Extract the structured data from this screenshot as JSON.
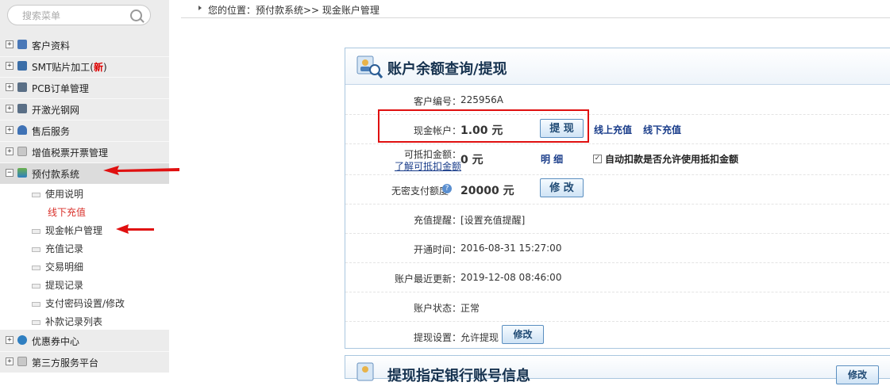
{
  "sidebar": {
    "search_placeholder": "搜索菜单",
    "menu": [
      {
        "label": "客户资料"
      },
      {
        "label": "SMT贴片加工(",
        "badge": "新",
        "suffix": ")"
      },
      {
        "label": "PCB订单管理"
      },
      {
        "label": "开激光钢网"
      },
      {
        "label": "售后服务"
      },
      {
        "label": "增值税票开票管理"
      },
      {
        "label": "预付款系统"
      }
    ],
    "submenu": [
      {
        "label": "使用说明"
      },
      {
        "label": "线下充值"
      },
      {
        "label": "现金帐户管理"
      },
      {
        "label": "充值记录"
      },
      {
        "label": "交易明细"
      },
      {
        "label": "提现记录"
      },
      {
        "label": "支付密码设置/修改"
      },
      {
        "label": "补款记录列表"
      }
    ],
    "menu_bottom": [
      {
        "label": "优惠券中心"
      },
      {
        "label": "第三方服务平台"
      }
    ]
  },
  "breadcrumb": "您的位置：预付款系统>> 现金账户管理",
  "panel": {
    "title": "账户余额查询/提现",
    "customer_id_label": "客户编号：",
    "customer_id": "225956A",
    "cash_label": "现金帐户：",
    "cash_value": "1.00 元",
    "withdraw_button": "提 现",
    "online_recharge": "线上充值",
    "offline_recharge": "线下充值",
    "deductible_label": "可抵扣金额：",
    "deductible_link": "了解可抵扣金额",
    "deductible_value": "0 元",
    "detail_link": "明 细",
    "auto_deduct_label": "自动扣款是否允许使用抵扣金额",
    "auto_deduct_checked": true,
    "nopwd_label": "无密支付额度",
    "nopwd_value": "20000 元",
    "modify_button": "修 改",
    "reminder_label": "充值提醒：",
    "reminder_value": "[设置充值提醒]",
    "open_time_label": "开通时间：",
    "open_time": "2016-08-31 15:27:00",
    "updated_label": "账户最近更新：",
    "updated_time": "2019-12-08 08:46:00",
    "status_label": "账户状态：",
    "status_value": "正常",
    "withdraw_setting_label": "提现设置：",
    "withdraw_setting_value": "允许提现",
    "withdraw_setting_button": "修改"
  },
  "panel2": {
    "title": "提现指定银行账号信息",
    "button": "修改"
  },
  "colors": {
    "accent_red": "#e00000",
    "link_blue": "#1a3d8a",
    "status_green": "#2e8a1e"
  }
}
